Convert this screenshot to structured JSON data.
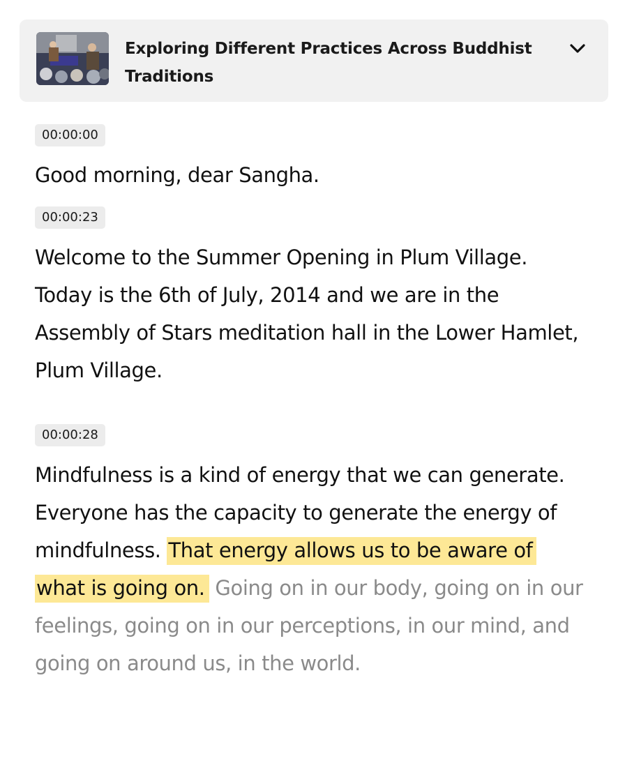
{
  "header": {
    "title": "Exploring Different Practices Across Buddhist Traditions",
    "thumbnail_icon": "video-thumbnail",
    "toggle_icon": "chevron-down-icon"
  },
  "transcript": {
    "segments": [
      {
        "timestamp": "00:00:00",
        "text": "Good morning, dear Sangha."
      },
      {
        "timestamp": "00:00:23",
        "text": "Welcome to the Summer Opening in Plum Village. Today is the 6th of July, 2014 and we are in the Assembly of Stars meditation hall in the Lower Hamlet, Plum Village."
      },
      {
        "timestamp": "00:00:28",
        "text_before": "Mindfulness is a kind of energy that we can generate. Everyone has the capacity to generate the energy of mindfulness. ",
        "text_current": "That energy allows us to be aware of what is going on.",
        "text_after": " Going on in our body, going on in our feelings, going on in our perceptions, in our mind, and going on around us, in the world."
      }
    ]
  },
  "colors": {
    "header_bg": "#f1f1f1",
    "timestamp_bg": "#ececec",
    "highlight": "#fde896",
    "upcoming_text": "#8a8a8a"
  }
}
